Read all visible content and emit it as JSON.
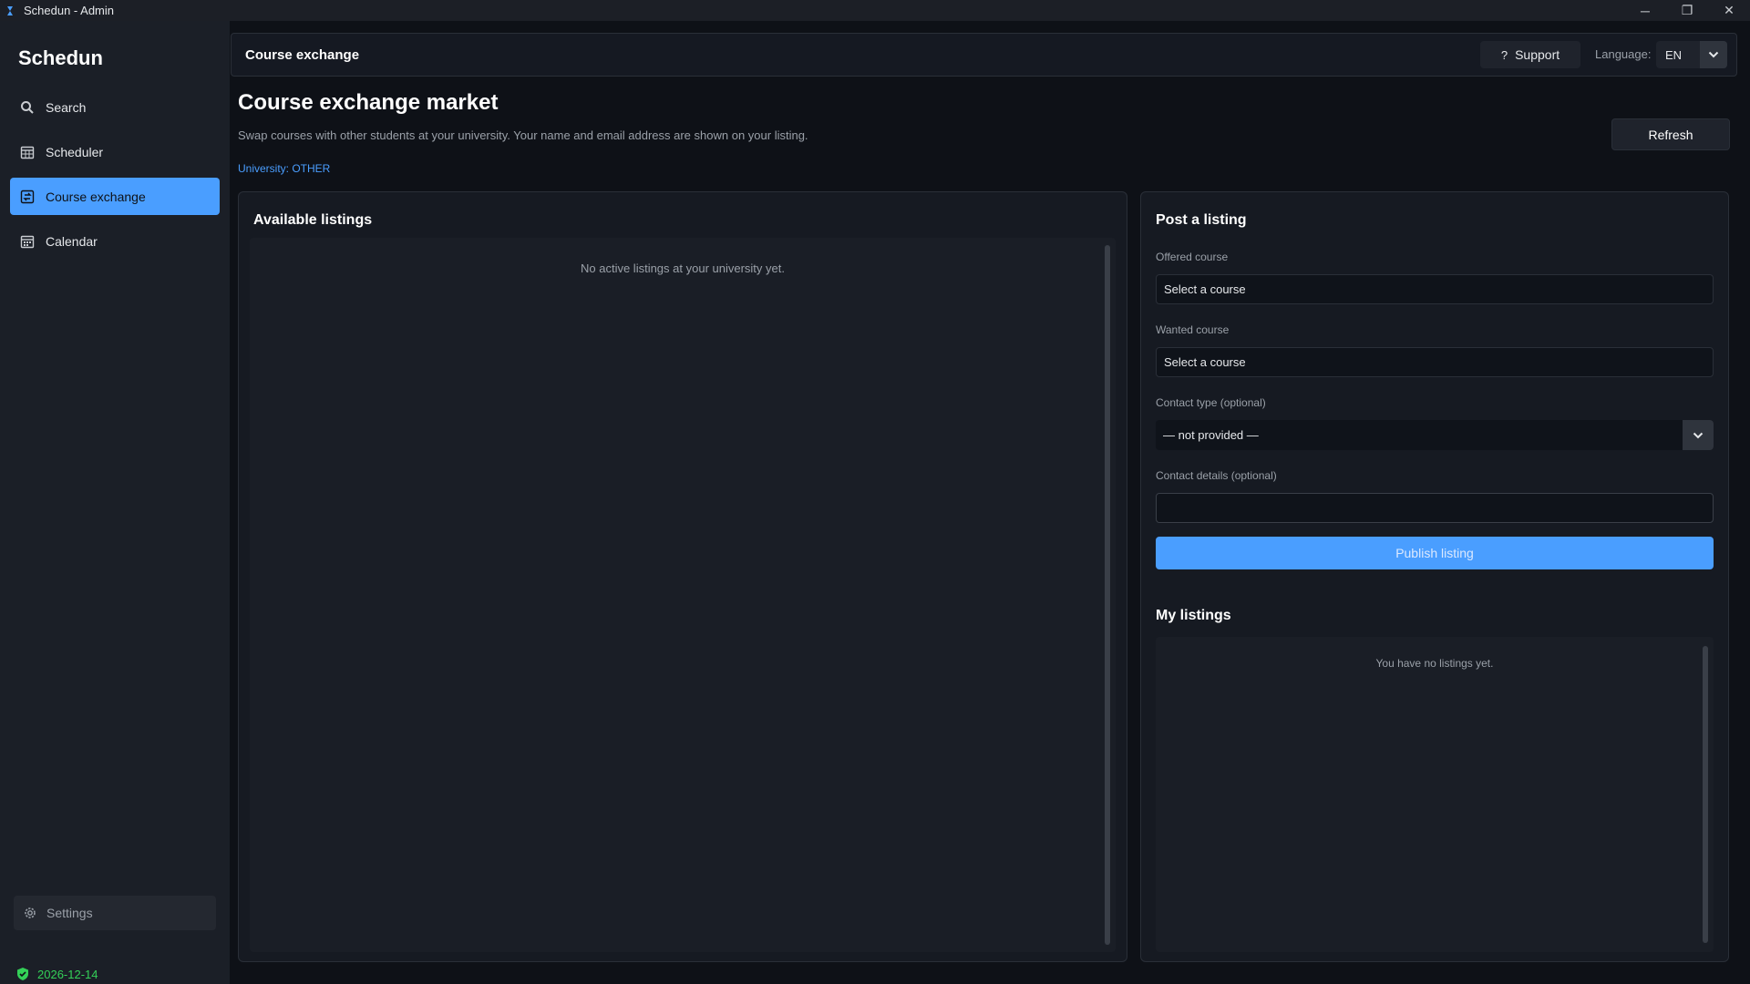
{
  "window": {
    "title": "Schedun - Admin",
    "controls": {
      "minimize": "─",
      "restore": "❐",
      "close": "✕"
    }
  },
  "sidebar": {
    "brand": "Schedun",
    "items": [
      {
        "label": "Search",
        "icon": "search-icon",
        "active": false
      },
      {
        "label": "Scheduler",
        "icon": "calendar-grid-icon",
        "active": false
      },
      {
        "label": "Course exchange",
        "icon": "exchange-icon",
        "active": true
      },
      {
        "label": "Calendar",
        "icon": "calendar-icon",
        "active": false
      }
    ],
    "settings_label": "Settings",
    "status_date": "2026-12-14"
  },
  "header": {
    "breadcrumb": "Course exchange",
    "support_label": "Support",
    "support_icon": "?",
    "language_label": "Language:",
    "language_value": "EN"
  },
  "page": {
    "title": "Course exchange market",
    "subtitle": "Swap courses with other students at your university. Your name and email address are shown on your listing.",
    "university": "University: OTHER",
    "refresh_label": "Refresh"
  },
  "available": {
    "title": "Available listings",
    "empty": "No active listings at your university yet."
  },
  "post": {
    "title": "Post a listing",
    "offered_label": "Offered course",
    "offered_value": "Select a course",
    "wanted_label": "Wanted course",
    "wanted_value": "Select a course",
    "contact_type_label": "Contact type (optional)",
    "contact_type_value": "— not provided —",
    "contact_details_label": "Contact details (optional)",
    "contact_details_value": "",
    "publish_label": "Publish listing"
  },
  "my_listings": {
    "title": "My listings",
    "empty": "You have no listings yet."
  },
  "colors": {
    "accent": "#4a9eff",
    "status_ok": "#34d058",
    "background": "#0e1117",
    "sidebar": "#1b1f27"
  }
}
